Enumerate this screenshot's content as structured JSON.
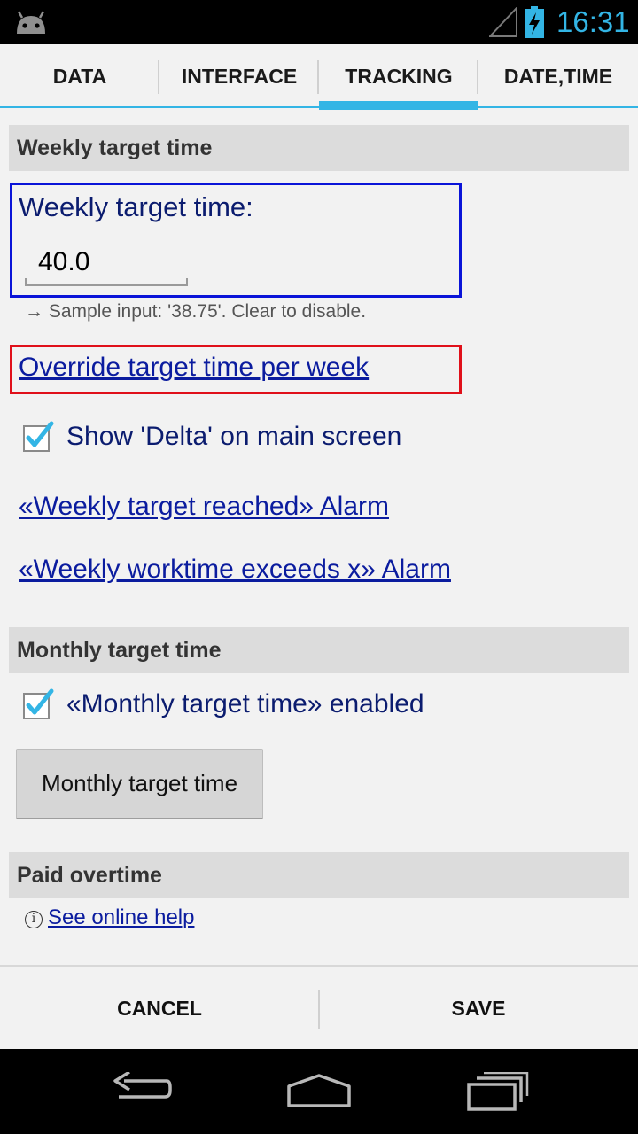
{
  "status_bar": {
    "time": "16:31",
    "accent_color": "#33b5e5",
    "icons": [
      "android-icon",
      "signal-icon",
      "battery-charging-icon"
    ]
  },
  "tabs": [
    {
      "label": "DATA",
      "active": false
    },
    {
      "label": "INTERFACE",
      "active": false
    },
    {
      "label": "TRACKING",
      "active": true
    },
    {
      "label": "DATE,TIME",
      "active": false
    }
  ],
  "weekly": {
    "header": "Weekly target time",
    "field_label": "Weekly target time:",
    "value": "40.0",
    "hint": "→ Sample input: '38.75'. Clear to disable.",
    "override_link": "Override target time per week",
    "show_delta_label": "Show 'Delta' on main screen",
    "show_delta_checked": true,
    "reached_alarm_link": "«Weekly target reached» Alarm",
    "exceeds_alarm_link": "«Weekly worktime exceeds x» Alarm"
  },
  "monthly": {
    "header": "Monthly target time",
    "enabled_label": "«Monthly target time» enabled",
    "enabled_checked": true,
    "button_label": "Monthly target time"
  },
  "paid_overtime": {
    "header": "Paid overtime",
    "help_link": "See online help"
  },
  "footer": {
    "cancel": "CANCEL",
    "save": "SAVE"
  },
  "colors": {
    "highlight_blue": "#0a14d8",
    "highlight_red": "#e0101a",
    "link": "#0b1c9f"
  }
}
